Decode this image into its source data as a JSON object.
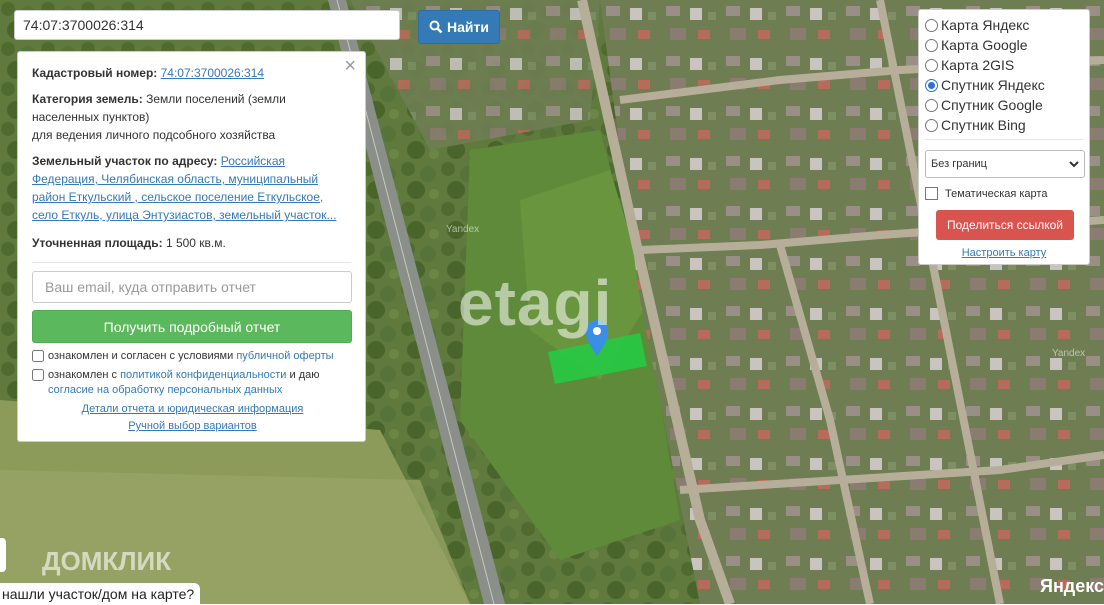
{
  "search": {
    "value": "74:07:3700026:314",
    "button_label": "Найти"
  },
  "info": {
    "cad_label": "Кадастровый номер:",
    "cad_value": "74:07:3700026:314",
    "category_label": "Категория земель:",
    "category_value": "Земли поселений (земли населенных пунктов)",
    "usage": "для ведения личного подсобного хозяйства",
    "address_label": "Земельный участок по адресу:",
    "address_value": "Российская Федерация, Челябинская область, муниципальный район Еткульский , сельское поселение Еткульское, село Еткуль, улица Энтузиастов, земельный участок...",
    "area_label": "Уточненная площадь:",
    "area_value": "1 500 кв.м.",
    "email_placeholder": "Ваш email, куда отправить отчет",
    "report_button": "Получить подробный отчет",
    "agree1_text": "ознакомлен и согласен с условиями",
    "agree1_link": "публичной оферты",
    "agree2_text": "ознакомлен с",
    "agree2_link": "политикой конфиденциальности",
    "agree2_tail": "и даю",
    "agree2_link2": "согласие на обработку персональных данных",
    "details_link": "Детали отчета и юридическая информация",
    "manual_link": "Ручной выбор вариантов"
  },
  "layers": {
    "options": [
      "Карта Яндекс",
      "Карта Google",
      "Карта 2GIS",
      "Спутник Яндекс",
      "Спутник Google",
      "Спутник Bing"
    ],
    "selected_index": 3,
    "select_value": "Без границ",
    "thematic_label": "Тематическая карта",
    "share_button": "Поделиться ссылкой",
    "configure_link": "Настроить карту"
  },
  "bubble_text": "нашли участок/дом на карте?",
  "watermarks": {
    "etagi": "etagi",
    "domclick": "ДОМКЛИК",
    "yandex_logo": "Яндекс",
    "yandex_small": "Yandex"
  },
  "colors": {
    "primary": "#337ab7",
    "success": "#5cb85c",
    "danger": "#d9534f",
    "parcel": "#22cc44"
  }
}
